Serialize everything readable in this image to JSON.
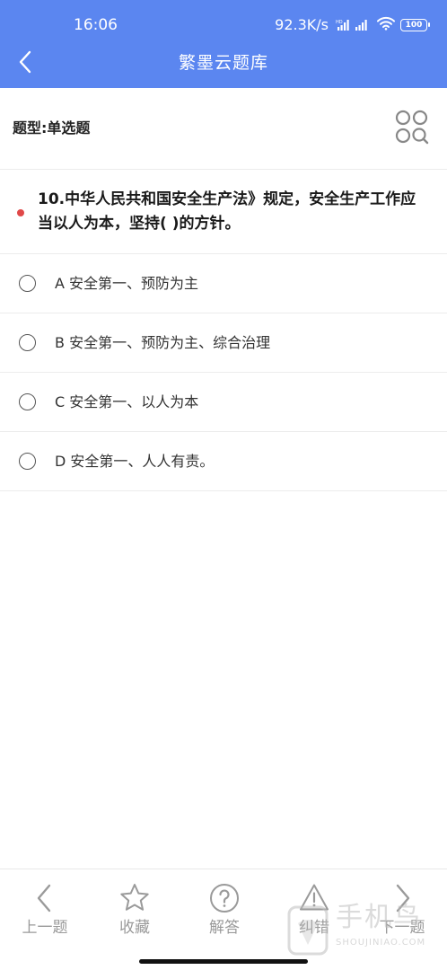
{
  "status_bar": {
    "time": "16:06",
    "net_speed": "92.3K/s",
    "battery": "100"
  },
  "nav": {
    "title": "繁墨云题库"
  },
  "question_type": {
    "label": "题型:单选题"
  },
  "question": {
    "text": "10.中华人民共和国安全生产法》规定，安全生产工作应当以人为本，坚持( )的方针。"
  },
  "options": [
    {
      "text": "A 安全第一、预防为主"
    },
    {
      "text": "B 安全第一、预防为主、综合治理"
    },
    {
      "text": "C 安全第一、以人为本"
    },
    {
      "text": "D 安全第一、人人有责。"
    }
  ],
  "bottom_bar": {
    "prev": "上一题",
    "favorite": "收藏",
    "answer": "解答",
    "report": "纠错",
    "next": "下一题"
  },
  "watermark": {
    "text": "手机鸟",
    "sub": "SHOUJINIAO.COM"
  },
  "colors": {
    "header": "#5b86f0",
    "accent_dot": "#e04848",
    "bar_icon": "#9a9a9a"
  }
}
